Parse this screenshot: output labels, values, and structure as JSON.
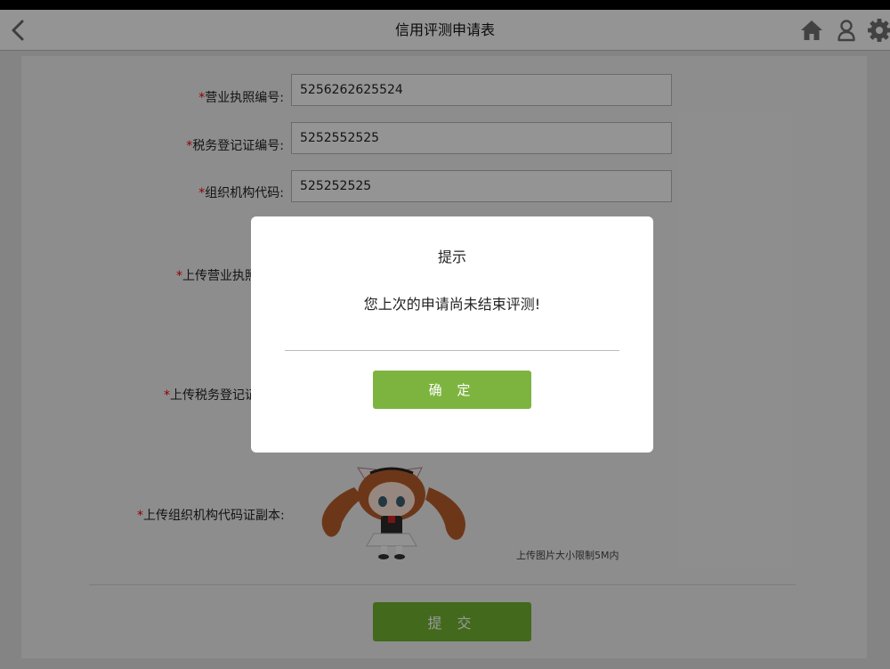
{
  "header": {
    "title": "信用评测申请表"
  },
  "icons": {
    "back": "chevron-left-icon",
    "home": "home-icon",
    "user": "user-icon",
    "settings": "gear-icon"
  },
  "form": {
    "required_mark": "*",
    "license_no": {
      "label": "营业执照编号:",
      "value": "5256262625524"
    },
    "tax_no": {
      "label": "税务登记证编号:",
      "value": "5252552525"
    },
    "org_code": {
      "label": "组织机构代码:",
      "value": "525252525"
    },
    "upload_license": {
      "label": "上传营业执照"
    },
    "upload_tax": {
      "label": "上传税务登记证"
    },
    "upload_org": {
      "label": "上传组织机构代码证副本:"
    },
    "upload_hint": "上传图片大小限制5M内",
    "submit_label": "提 交"
  },
  "dialog": {
    "title": "提示",
    "message": "您上次的申请尚未结束评测!",
    "confirm_label": "确 定"
  },
  "colors": {
    "accent_green": "#7db43f",
    "required_red": "#e00000"
  }
}
